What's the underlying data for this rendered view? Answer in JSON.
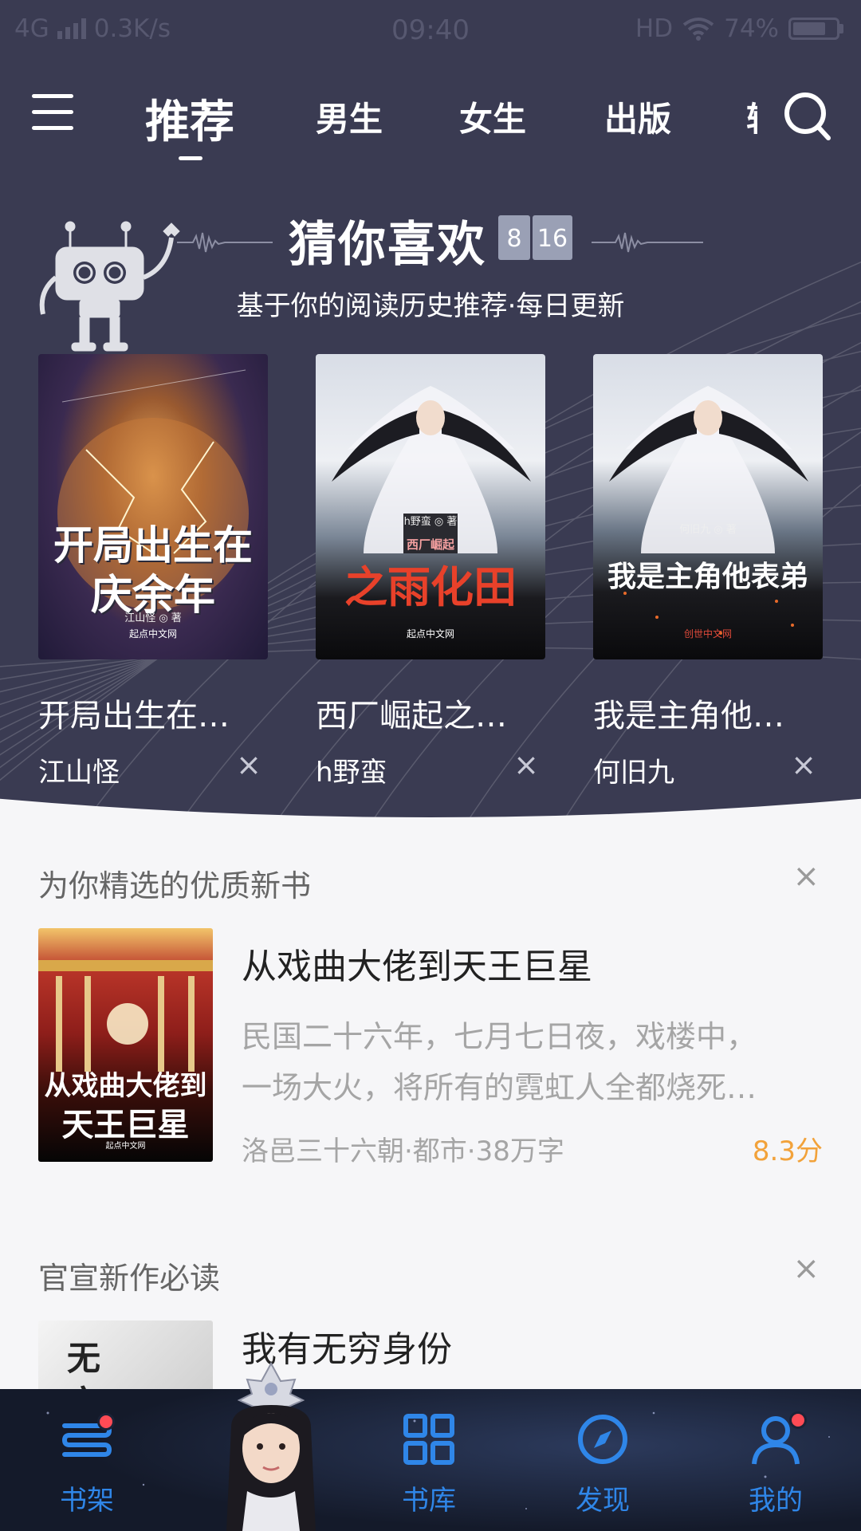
{
  "status_bar": {
    "network": "4G",
    "speed": "0.3K/s",
    "time": "09:40",
    "hd": "HD",
    "battery": "74%"
  },
  "top_nav": {
    "tabs": [
      {
        "label": "推荐"
      },
      {
        "label": "男生"
      },
      {
        "label": "女生"
      },
      {
        "label": "出版"
      }
    ],
    "partial_tab": "轻"
  },
  "guess": {
    "title": "猜你喜欢",
    "date_month": "8",
    "date_day": "16",
    "subtitle": "基于你的阅读历史推荐·每日更新",
    "books": [
      {
        "name": "开局出生在…",
        "author": "江山怪",
        "cover_title_l1": "开局出生在",
        "cover_title_l2": "庆余年",
        "cover_author": "江山怪 ◎ 著",
        "cover_pub": "起点中文网"
      },
      {
        "name": "西厂崛起之…",
        "author": "h野蛮",
        "cover_title_l1": "之雨化田",
        "cover_title_l2": "西厂崛起",
        "cover_author": "h野蛮 ◎ 著",
        "cover_pub": "起点中文网"
      },
      {
        "name": "我是主角他…",
        "author": "何旧九",
        "cover_title_l1": "我是主角他表弟",
        "cover_author": "何旧九 ◎ 著",
        "cover_pub": "创世中文网"
      }
    ],
    "close_glyph": "×"
  },
  "featured": {
    "heading": "为你精选的优质新书",
    "book": {
      "title": "从戏曲大佬到天王巨星",
      "desc_line1": "民国二十六年，七月七日夜，戏楼中，",
      "desc_line2": "一场大火，将所有的霓虹人全都烧死…",
      "meta": "洛邑三十六朝·都市·38万字",
      "score": "8.3分",
      "cover_title_l1": "从戏曲大佬到",
      "cover_title_l2": "天王巨星",
      "cover_pub": "起点中文网"
    }
  },
  "official": {
    "heading": "官宣新作必读",
    "book": {
      "title": "我有无穷身份",
      "cover_text": "无穷"
    }
  },
  "bottom_nav": [
    {
      "label": "书架",
      "icon": "bookshelf-icon"
    },
    {
      "label": "书库",
      "icon": "grid-icon"
    },
    {
      "label": "发现",
      "icon": "compass-icon"
    },
    {
      "label": "我的",
      "icon": "user-icon"
    }
  ],
  "colors": {
    "header_bg": "#3a3b52",
    "accent_blue": "#2f86e8",
    "score_orange": "#f2a23a",
    "badge_red": "#ff4b55"
  }
}
